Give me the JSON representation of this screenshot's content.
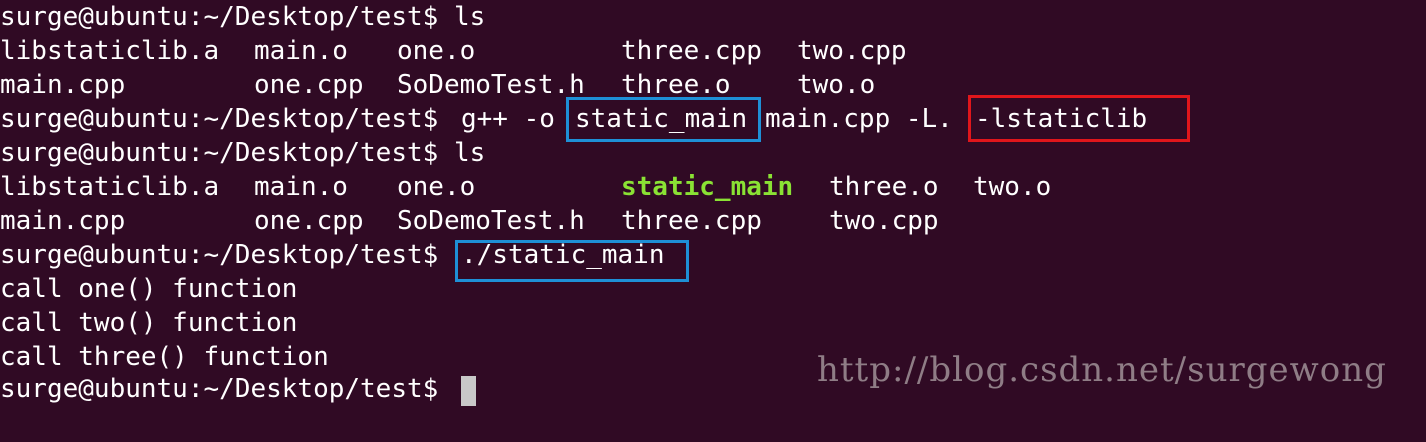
{
  "terminal": {
    "lines": [
      "surge@ubuntu:~/Desktop/test$ ls",
      {
        "cols": [
          "libstaticlib.a",
          "main.o",
          "one.o",
          "three.cpp",
          "two.cpp"
        ]
      },
      {
        "cols": [
          "main.cpp",
          "one.cpp",
          "SoDemoTest.h",
          "three.o",
          "two.o"
        ]
      },
      {
        "prompt": "surge@ubuntu:~/Desktop/test$",
        "cmd_a": "g++ -o",
        "cmd_b": "static_main",
        "cmd_c": "main.cpp -L.",
        "cmd_d": "-lstaticlib"
      },
      "surge@ubuntu:~/Desktop/test$ ls",
      {
        "cols": [
          "libstaticlib.a",
          "main.o",
          "one.o",
          "static_main",
          "three.o",
          "two.o"
        ]
      },
      {
        "cols": [
          "main.cpp",
          "one.cpp",
          "SoDemoTest.h",
          "three.cpp",
          "two.cpp"
        ]
      },
      {
        "prompt": "surge@ubuntu:~/Desktop/test$",
        "cmd": "./static_main"
      },
      "call one() function",
      "call two() function",
      "call three() function",
      "surge@ubuntu:~/Desktop/test$"
    ]
  },
  "watermark": "http://blog.csdn.net/surgewong",
  "colors": {
    "background": "#300a24",
    "text": "#ffffff",
    "executable": "#8ae234",
    "highlight_blue": "#1e90d6",
    "highlight_red": "#e0161b"
  }
}
